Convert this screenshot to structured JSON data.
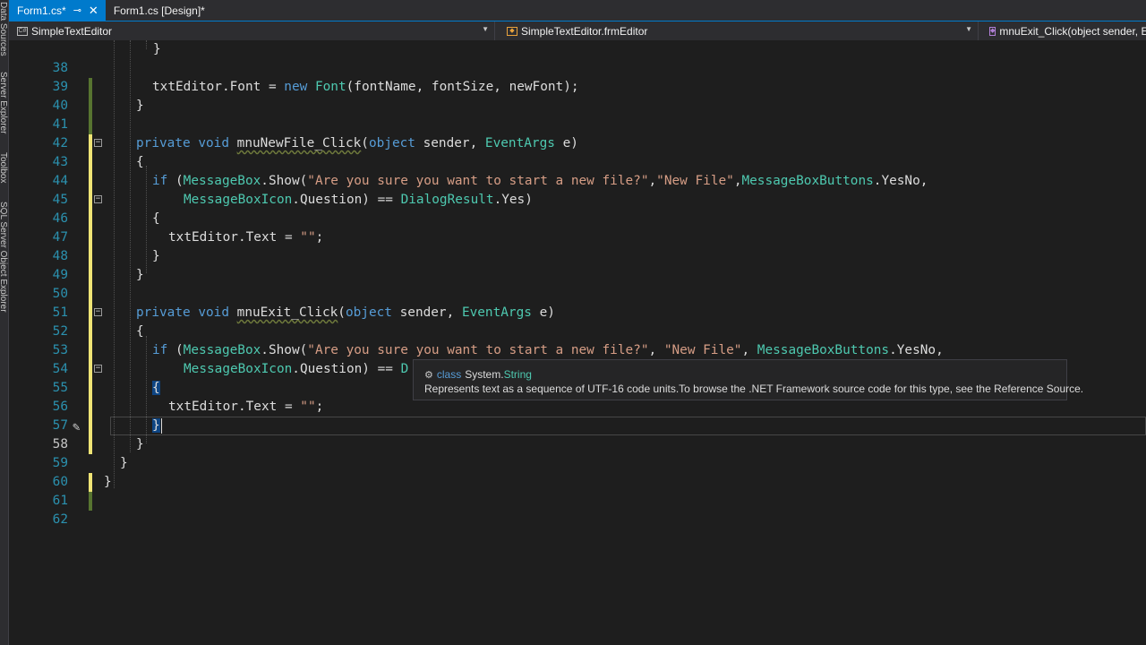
{
  "side_strip": {
    "labels": [
      "Data Sources",
      "Server Explorer",
      "Toolbox",
      "SQL Server Object Explorer"
    ]
  },
  "tabs": [
    {
      "label": "Form1.cs*",
      "active": true,
      "pin_icon": "pin-icon",
      "close_icon": "close-icon"
    },
    {
      "label": "Form1.cs [Design]*",
      "active": false
    }
  ],
  "navbar": {
    "project": "SimpleTextEditor",
    "class": "SimpleTextEditor.frmEditor",
    "member": "mnuExit_Click(object sender, EventArgs e)"
  },
  "editor": {
    "line_numbers": [
      "38",
      "39",
      "40",
      "41",
      "42",
      "43",
      "44",
      "45",
      "46",
      "47",
      "48",
      "49",
      "50",
      "51",
      "52",
      "53",
      "54",
      "55",
      "56",
      "57",
      "58",
      "59",
      "60",
      "61",
      "62"
    ],
    "current_line": "58"
  },
  "tooltip": {
    "kind": "class",
    "namespace": "System.",
    "type": "String",
    "description": "Represents text as a sequence of UTF-16 code units.To browse the .NET Framework source code for this type, see the Reference Source."
  },
  "colors": {
    "accent": "#007acc",
    "keyword": "#569cd6",
    "type": "#4ec9b0",
    "string": "#d69d85",
    "line_number": "#2b91af"
  }
}
